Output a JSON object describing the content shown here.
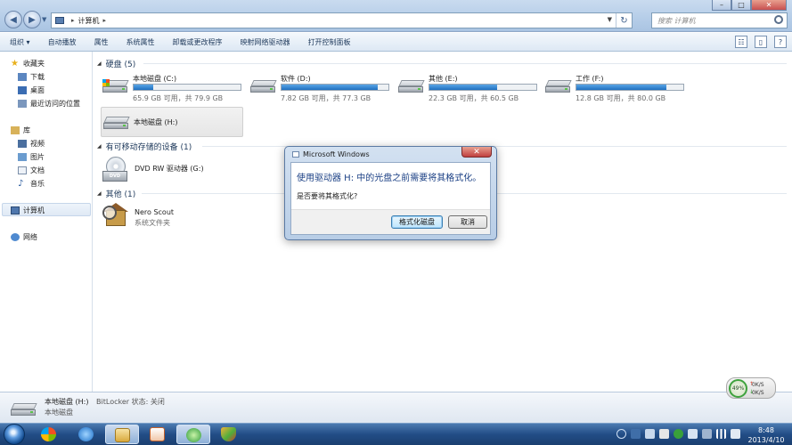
{
  "window": {
    "breadcrumb": [
      "计算机"
    ],
    "search_placeholder": "搜索 计算机",
    "controls": {
      "minimize": "–",
      "maximize": "□",
      "close": "✕"
    }
  },
  "toolbar": {
    "items": [
      "组织 ▾",
      "自动播放",
      "属性",
      "系统属性",
      "卸载或更改程序",
      "映射网络驱动器",
      "打开控制面板"
    ]
  },
  "navpane": {
    "favorites": "收藏夹",
    "favorites_items": [
      "下载",
      "桌面",
      "最近访问的位置"
    ],
    "libraries": "库",
    "library_items": [
      "视频",
      "图片",
      "文档",
      "音乐"
    ],
    "computer": "计算机",
    "network": "网络"
  },
  "groups": {
    "hard_disks": "硬盘 (5)",
    "removable": "有可移动存储的设备 (1)",
    "other": "其他 (1)"
  },
  "drives": [
    {
      "name": "本地磁盘 (C:)",
      "info": "65.9 GB 可用，共 79.9 GB",
      "used_fraction": 0.18
    },
    {
      "name": "软件 (D:)",
      "info": "7.82 GB 可用，共 77.3 GB",
      "used_fraction": 0.9
    },
    {
      "name": "其他 (E:)",
      "info": "22.3 GB 可用，共 60.5 GB",
      "used_fraction": 0.63
    },
    {
      "name": "工作 (F:)",
      "info": "12.8 GB 可用，共 80.0 GB",
      "used_fraction": 0.84
    },
    {
      "name": "本地磁盘 (H:)"
    }
  ],
  "removable": {
    "name": "DVD RW 驱动器 (G:)",
    "icon_label": "DVD"
  },
  "other_item": {
    "name": "Nero Scout",
    "sub": "系统文件夹"
  },
  "details": {
    "name": "本地磁盘 (H:)",
    "bitlocker": "BitLocker 状态: 关闭",
    "type": "本地磁盘"
  },
  "gadget": {
    "percent": "49%",
    "up": "0K/S",
    "down": "0K/S"
  },
  "clock": {
    "time": "8:48",
    "date": "2013/4/10"
  },
  "dialog": {
    "title": "Microsoft Windows",
    "message": "使用驱动器 H: 中的光盘之前需要将其格式化。",
    "question": "是否要将其格式化?",
    "primary_button": "格式化磁盘",
    "cancel_button": "取消"
  }
}
